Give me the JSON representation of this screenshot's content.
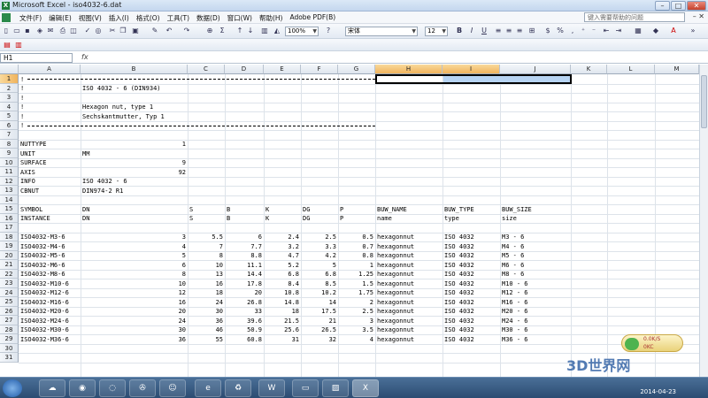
{
  "window": {
    "title": "Microsoft Excel - iso4032-6.dat"
  },
  "menu": {
    "items": [
      "文件(F)",
      "编辑(E)",
      "视图(V)",
      "插入(I)",
      "格式(O)",
      "工具(T)",
      "数据(D)",
      "窗口(W)",
      "帮助(H)",
      "Adobe PDF(B)"
    ],
    "help_placeholder": "键入需要帮助的问题"
  },
  "toolbar": {
    "zoom": "100%",
    "font": "宋体",
    "font_size": "12"
  },
  "formula": {
    "namebox": "H1",
    "fx": "fx",
    "content": ""
  },
  "grid": {
    "columns": [
      "A",
      "B",
      "C",
      "D",
      "E",
      "F",
      "G",
      "H",
      "I",
      "J",
      "K",
      "L",
      "M"
    ],
    "rows": [
      "1",
      "2",
      "3",
      "4",
      "5",
      "6",
      "7",
      "8",
      "9",
      "10",
      "11",
      "12",
      "13",
      "14",
      "15",
      "16",
      "17",
      "18",
      "19",
      "20",
      "21",
      "22",
      "23",
      "24",
      "25",
      "26",
      "27",
      "28",
      "29",
      "30",
      "31"
    ],
    "text": {
      "r2a": "!",
      "r2b": "ISO 4032 - 6 (DIN934)",
      "r3a": "!",
      "r4a": "!",
      "r4b": "Hexagon nut, type 1",
      "r5a": "!",
      "r5b": "Sechskantmutter, Typ 1",
      "r1a": "!",
      "r6a": "!",
      "r8a": "NUTTYPE",
      "r8b": "1",
      "r9a": "UNIT",
      "r9b": "MM",
      "r10a": "SURFACE",
      "r10b": "9",
      "r11a": "AXIS",
      "r11b": "92",
      "r12a": "INFO",
      "r12b": "ISO 4032 - 6",
      "r13a": "CBNUT",
      "r13b": "DIN974-2 R1",
      "r15": [
        "SYMBOL",
        "DN",
        "S",
        "B",
        "K",
        "DG",
        "P",
        "BUW_NAME",
        "BUW_TYPE",
        "BUW_SIZE"
      ],
      "r16": [
        "INSTANCE",
        "DN",
        "S",
        "B",
        "K",
        "DG",
        "P",
        "name",
        "type",
        "size"
      ]
    },
    "data_rows": [
      [
        "ISO4032-M3-6",
        "3",
        "5.5",
        "6",
        "2.4",
        "2.5",
        "0.5",
        "hexagonnut",
        "ISO 4032",
        "M3 - 6"
      ],
      [
        "ISO4032-M4-6",
        "4",
        "7",
        "7.7",
        "3.2",
        "3.3",
        "0.7",
        "hexagonnut",
        "ISO 4032",
        "M4 - 6"
      ],
      [
        "ISO4032-M5-6",
        "5",
        "8",
        "8.8",
        "4.7",
        "4.2",
        "0.8",
        "hexagonnut",
        "ISO 4032",
        "M5 - 6"
      ],
      [
        "ISO4032-M6-6",
        "6",
        "10",
        "11.1",
        "5.2",
        "5",
        "1",
        "hexagonnut",
        "ISO 4032",
        "M6 - 6"
      ],
      [
        "ISO4032-M8-6",
        "8",
        "13",
        "14.4",
        "6.8",
        "6.8",
        "1.25",
        "hexagonnut",
        "ISO 4032",
        "M8 - 6"
      ],
      [
        "ISO4032-M10-6",
        "10",
        "16",
        "17.8",
        "8.4",
        "8.5",
        "1.5",
        "hexagonnut",
        "ISO 4032",
        "M10 - 6"
      ],
      [
        "ISO4032-M12-6",
        "12",
        "18",
        "20",
        "10.8",
        "10.2",
        "1.75",
        "hexagonnut",
        "ISO 4032",
        "M12 - 6"
      ],
      [
        "ISO4032-M16-6",
        "16",
        "24",
        "26.8",
        "14.8",
        "14",
        "2",
        "hexagonnut",
        "ISO 4032",
        "M16 - 6"
      ],
      [
        "ISO4032-M20-6",
        "20",
        "30",
        "33",
        "18",
        "17.5",
        "2.5",
        "hexagonnut",
        "ISO 4032",
        "M20 - 6"
      ],
      [
        "ISO4032-M24-6",
        "24",
        "36",
        "39.6",
        "21.5",
        "21",
        "3",
        "hexagonnut",
        "ISO 4032",
        "M24 - 6"
      ],
      [
        "ISO4032-M30-6",
        "30",
        "46",
        "50.9",
        "25.6",
        "26.5",
        "3.5",
        "hexagonnut",
        "ISO 4032",
        "M30 - 6"
      ],
      [
        "ISO4032-M36-6",
        "36",
        "55",
        "60.8",
        "31",
        "32",
        "4",
        "hexagonnut",
        "ISO 4032",
        "M36 - 6"
      ]
    ]
  },
  "taskbar": {
    "date": "2014-04-23"
  },
  "widget": {
    "line1": "0.0K/S",
    "line2": "0KC"
  },
  "watermark": "3D世界网"
}
